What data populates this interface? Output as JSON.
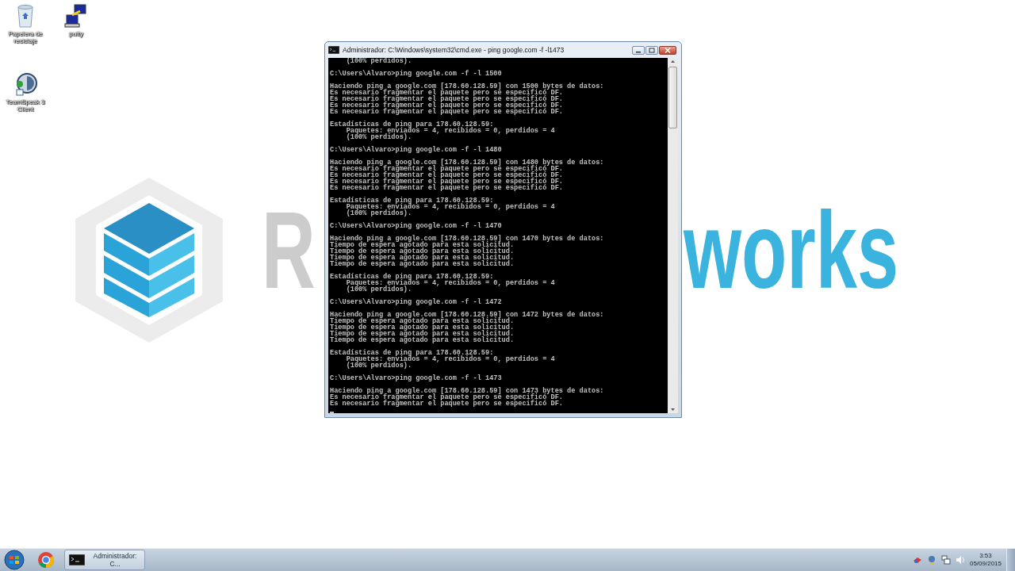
{
  "desktop_icons": [
    {
      "kind": "recycle",
      "label": "Papelera de reciclaje"
    },
    {
      "kind": "putty",
      "label": "putty"
    },
    {
      "kind": "teamspeak",
      "label": "TeamSpeak 3 Client"
    }
  ],
  "wallpaper": {
    "text_left": "R",
    "text_right": "works"
  },
  "window": {
    "title": "Administrador: C:\\Windows\\system32\\cmd.exe - ping  google.com -f -l1473",
    "console_blocks": [
      [
        "    (100% perdidos)."
      ],
      [
        "C:\\Users\\Alvaro>ping google.com -f -l 1500"
      ],
      [
        "Haciendo ping a google.com [178.60.128.59] con 1500 bytes de datos:",
        "Es necesario fragmentar el paquete pero se especificó DF.",
        "Es necesario fragmentar el paquete pero se especificó DF.",
        "Es necesario fragmentar el paquete pero se especificó DF.",
        "Es necesario fragmentar el paquete pero se especificó DF."
      ],
      [
        "Estadísticas de ping para 178.60.128.59:",
        "    Paquetes: enviados = 4, recibidos = 0, perdidos = 4",
        "    (100% perdidos)."
      ],
      [
        "C:\\Users\\Alvaro>ping google.com -f -l 1480"
      ],
      [
        "Haciendo ping a google.com [178.60.128.59] con 1480 bytes de datos:",
        "Es necesario fragmentar el paquete pero se especificó DF.",
        "Es necesario fragmentar el paquete pero se especificó DF.",
        "Es necesario fragmentar el paquete pero se especificó DF.",
        "Es necesario fragmentar el paquete pero se especificó DF."
      ],
      [
        "Estadísticas de ping para 178.60.128.59:",
        "    Paquetes: enviados = 4, recibidos = 0, perdidos = 4",
        "    (100% perdidos)."
      ],
      [
        "C:\\Users\\Alvaro>ping google.com -f -l 1470"
      ],
      [
        "Haciendo ping a google.com [178.60.128.59] con 1470 bytes de datos:",
        "Tiempo de espera agotado para esta solicitud.",
        "Tiempo de espera agotado para esta solicitud.",
        "Tiempo de espera agotado para esta solicitud.",
        "Tiempo de espera agotado para esta solicitud."
      ],
      [
        "Estadísticas de ping para 178.60.128.59:",
        "    Paquetes: enviados = 4, recibidos = 0, perdidos = 4",
        "    (100% perdidos)."
      ],
      [
        "C:\\Users\\Alvaro>ping google.com -f -l 1472"
      ],
      [
        "Haciendo ping a google.com [178.60.128.59] con 1472 bytes de datos:",
        "Tiempo de espera agotado para esta solicitud.",
        "Tiempo de espera agotado para esta solicitud.",
        "Tiempo de espera agotado para esta solicitud.",
        "Tiempo de espera agotado para esta solicitud."
      ],
      [
        "Estadísticas de ping para 178.60.128.59:",
        "    Paquetes: enviados = 4, recibidos = 0, perdidos = 4",
        "    (100% perdidos)."
      ],
      [
        "C:\\Users\\Alvaro>ping google.com -f -l 1473"
      ],
      [
        "Haciendo ping a google.com [178.60.128.59] con 1473 bytes de datos:",
        "Es necesario fragmentar el paquete pero se especificó DF.",
        "Es necesario fragmentar el paquete pero se especificó DF."
      ]
    ]
  },
  "taskbar": {
    "buttons": [
      {
        "kind": "cmd",
        "label": "Administrador: C...",
        "selected": true
      }
    ],
    "clock": {
      "time": "3:53",
      "date": "05/09/2015"
    }
  }
}
